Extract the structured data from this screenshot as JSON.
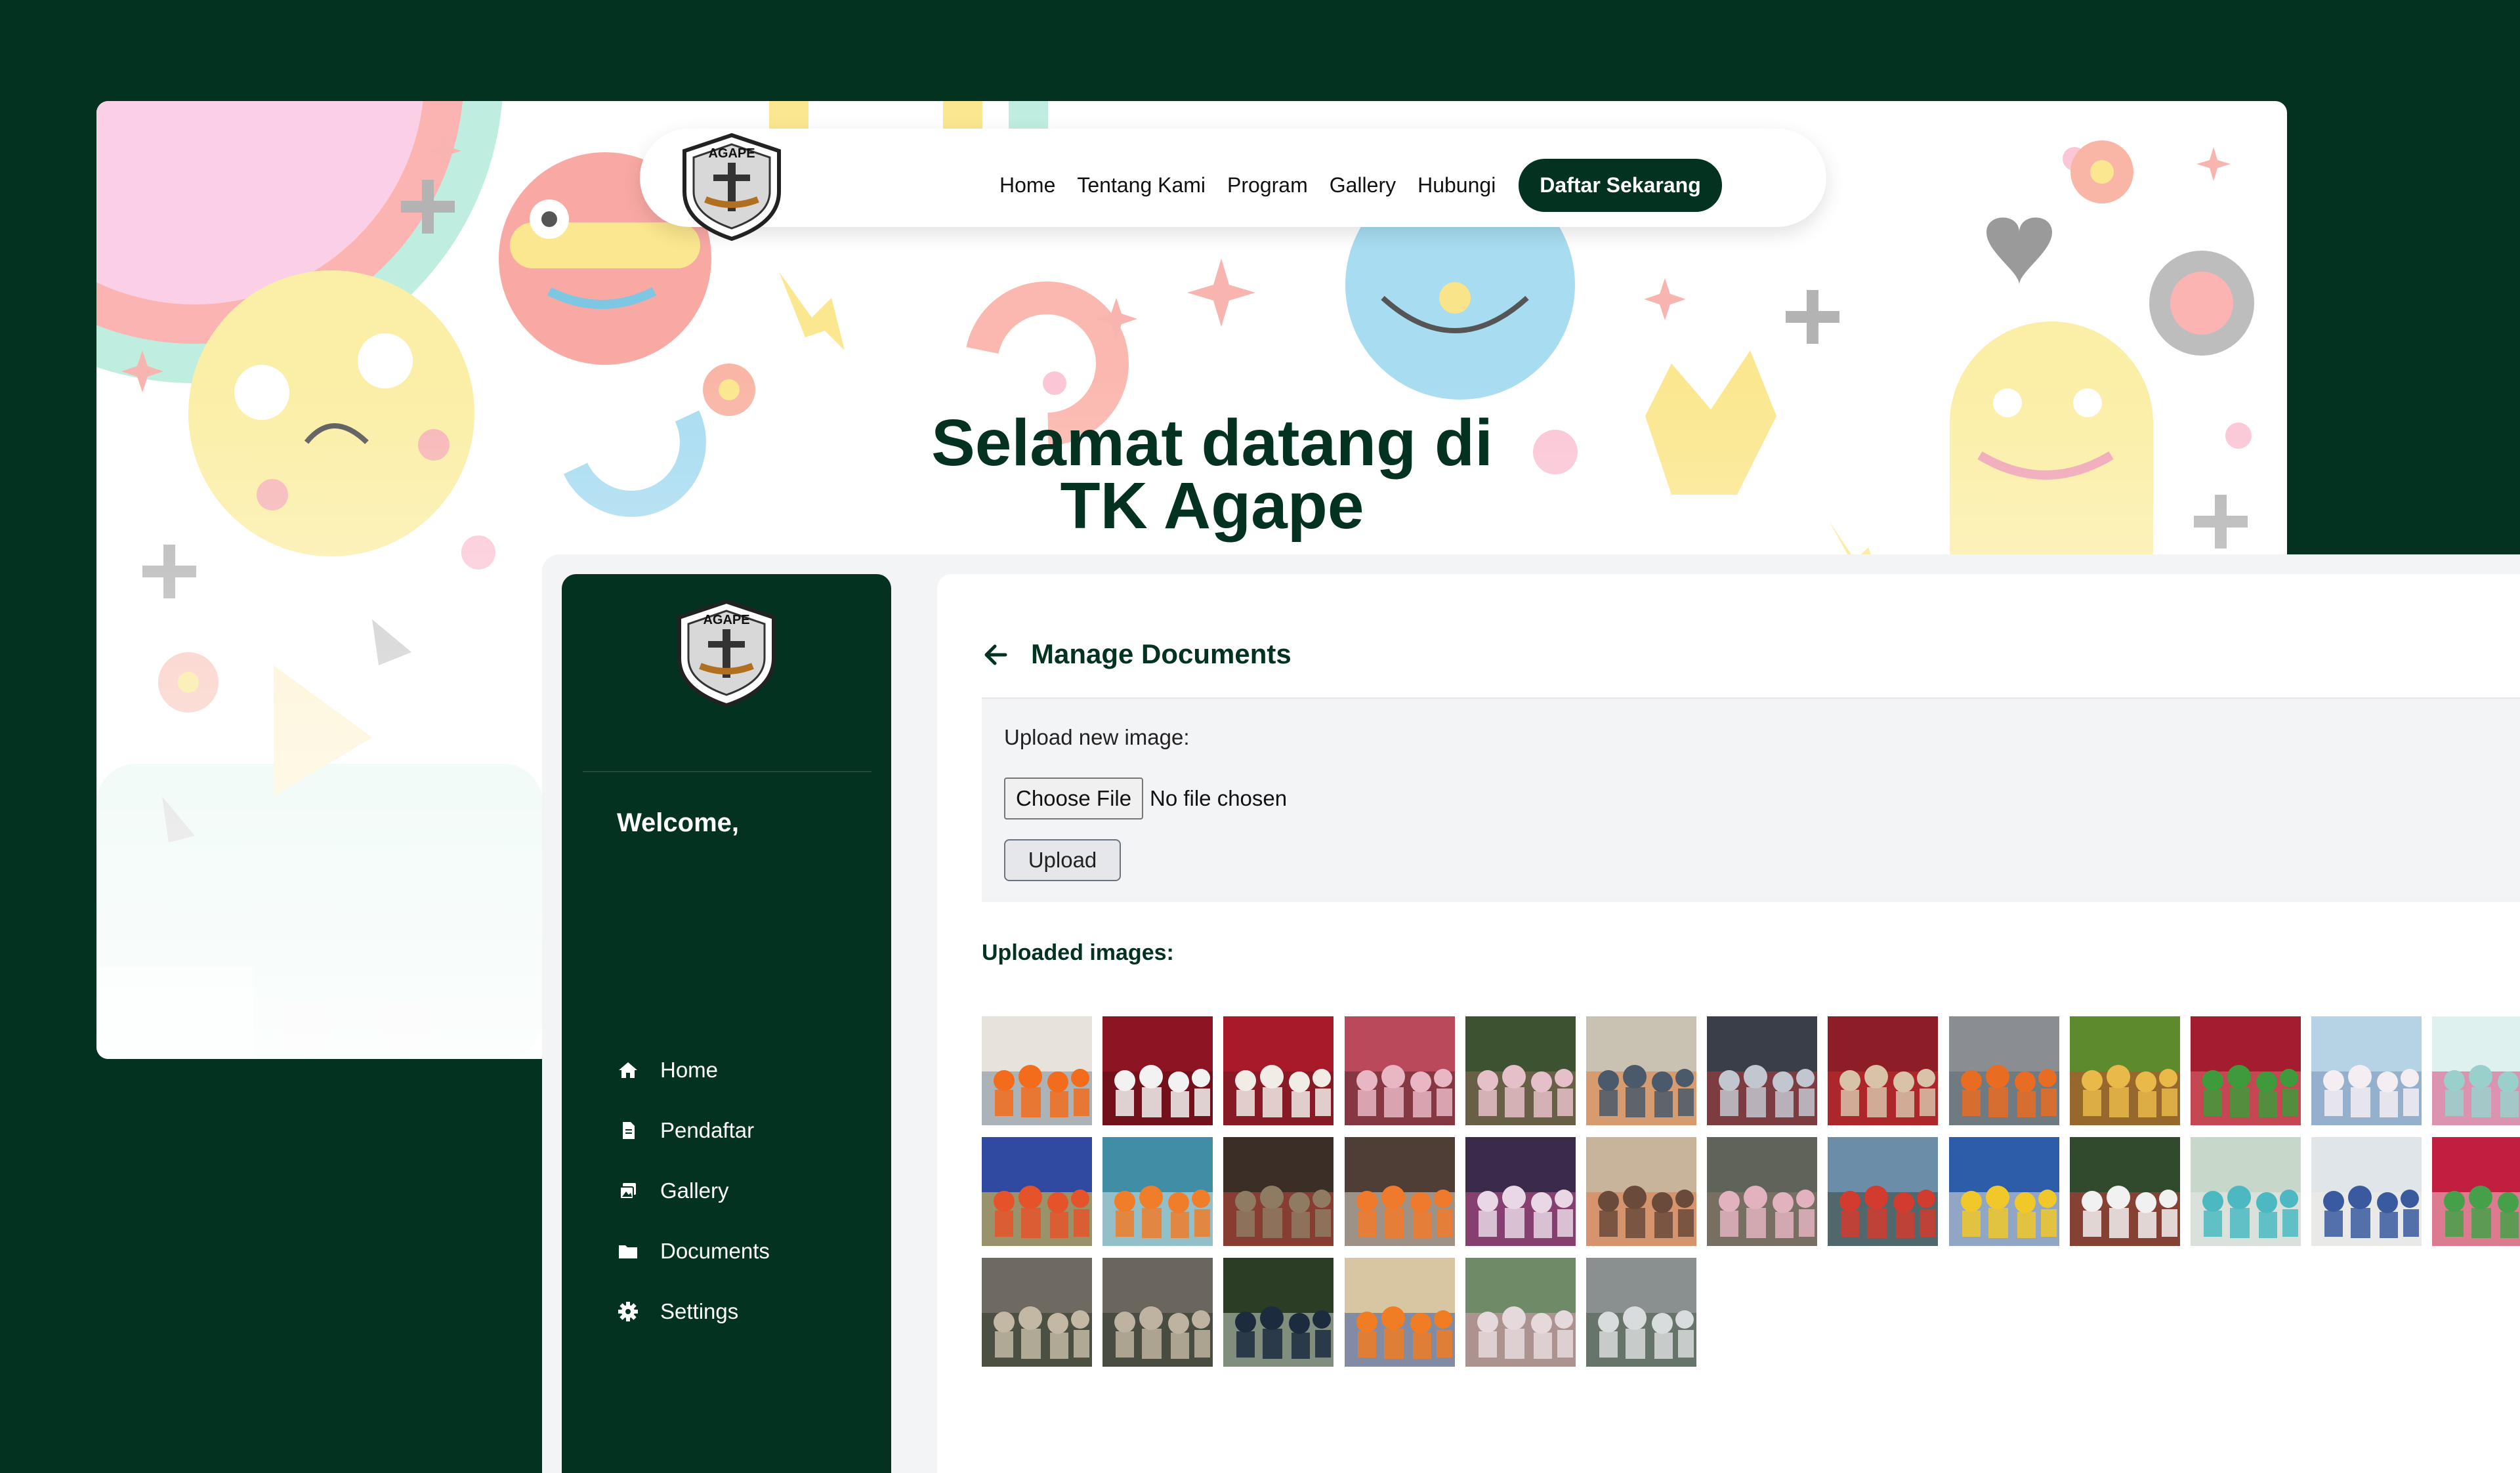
{
  "site": {
    "logo_text": "AGAPE",
    "nav_links": [
      "Home",
      "Tentang Kami",
      "Program",
      "Gallery",
      "Hubungi"
    ],
    "nav_cta": "Daftar Sekarang",
    "hero_title_line1": "Selamat datang di",
    "hero_title_line2": "TK Agape"
  },
  "admin": {
    "logo_text": "AGAPE",
    "welcome": "Welcome,",
    "menu": [
      {
        "label": "Home",
        "icon": "home-icon"
      },
      {
        "label": "Pendaftar",
        "icon": "document-icon"
      },
      {
        "label": "Gallery",
        "icon": "images-icon"
      },
      {
        "label": "Documents",
        "icon": "folder-icon"
      },
      {
        "label": "Settings",
        "icon": "gear-icon"
      }
    ],
    "page_title": "Manage Documents",
    "upload_label": "Upload new image:",
    "choose_file_label": "Choose File",
    "file_status": "No file chosen",
    "upload_button": "Upload",
    "uploaded_heading": "Uploaded images:"
  },
  "gallery": {
    "rows": [
      [
        "classroom-orange",
        "red-stage-dance",
        "group-white-stage",
        "pink-performance",
        "outdoor-pink-dresses",
        "classroom-group",
        "costume-parade",
        "red-stage-group",
        "outdoor-orange-play",
        "colorful-classroom",
        "green-costume-dance",
        "white-tutu-dance",
        "banner-event"
      ],
      [
        "blue-play-area",
        "long-table-meal",
        "seated-group-hall",
        "orange-uniform-group",
        "cake-celebration",
        "kids-at-desks",
        "pink-group-outdoor",
        "playground-red",
        "yellow-costume-kids",
        "kids-with-bags",
        "teacher-outdoor",
        "classroom-activity",
        "pink-stage-group"
      ],
      [
        "rock-wall-kid",
        "rock-wall-kid-2",
        "man-in-suit",
        "orange-kids-sitting",
        "outdoor-group-pink",
        "group-photo-building"
      ]
    ],
    "colors": {
      "classroom-orange": [
        "#e7e3dc",
        "#f26c1c",
        "#7a8a9a"
      ],
      "red-stage-dance": [
        "#8d1422",
        "#f2f2f2",
        "#5c0d15"
      ],
      "group-white-stage": [
        "#a8192a",
        "#f1ede6",
        "#6d1c22"
      ],
      "pink-performance": [
        "#b9495b",
        "#e8b7c3",
        "#5b2a2e"
      ],
      "outdoor-pink-dresses": [
        "#3d5230",
        "#e6c0c9",
        "#8a6a5a"
      ],
      "classroom-group": [
        "#c9c2b2",
        "#4a5a6a",
        "#e07b39"
      ],
      "costume-parade": [
        "#3a3e48",
        "#c2c6cf",
        "#b43a3a"
      ],
      "red-stage-group": [
        "#8d1d26",
        "#d8c3a9",
        "#c82e2e"
      ],
      "outdoor-orange-play": [
        "#8a8e92",
        "#e86c22",
        "#5a6a72"
      ],
      "colorful-classroom": [
        "#5e8a2e",
        "#e9b94a",
        "#c44d2d"
      ],
      "green-costume-dance": [
        "#a41d2e",
        "#3e9a3a",
        "#e06a72"
      ],
      "white-tutu-dance": [
        "#b6d3e6",
        "#f4eef2",
        "#7a93b6"
      ],
      "banner-event": [
        "#dff1ee",
        "#9ad0cc",
        "#d8467d"
      ],
      "blue-play-area": [
        "#2f4aa0",
        "#e5532a",
        "#f0d040"
      ],
      "long-table-meal": [
        "#3f8ea6",
        "#ef7d2a",
        "#d9e7e3"
      ],
      "seated-group-hall": [
        "#3b2e26",
        "#8f7a62",
        "#c74b3a"
      ],
      "orange-uniform-group": [
        "#4e3e36",
        "#f07a2b",
        "#e0d6c8"
      ],
      "cake-celebration": [
        "#3b2a4a",
        "#e9d7e5",
        "#c2528e"
      ],
      "kids-at-desks": [
        "#c8b49a",
        "#6a4a3a",
        "#e07a4a"
      ],
      "pink-group-outdoor": [
        "#5f635a",
        "#e2b3be",
        "#8c7a6b"
      ],
      "playground-red": [
        "#6b8da8",
        "#d13c2e",
        "#3a4a3a"
      ],
      "yellow-costume-kids": [
        "#2d5ca8",
        "#f0c829",
        "#e4e2dd"
      ],
      "kids-with-bags": [
        "#314a2e",
        "#f1f1f1",
        "#c83a3a"
      ],
      "teacher-outdoor": [
        "#c7d7c9",
        "#4bb8c2",
        "#e9e9e9"
      ],
      "classroom-activity": [
        "#dfe5e8",
        "#3a5aa0",
        "#f0eee8"
      ],
      "pink-stage-group": [
        "#c21e3f",
        "#46a04a",
        "#f2c9d4"
      ],
      "rock-wall-kid": [
        "#6e6a62",
        "#c2b8a4",
        "#2f3a2a"
      ],
      "rock-wall-kid-2": [
        "#6a665e",
        "#bdb3a0",
        "#2d3628"
      ],
      "man-in-suit": [
        "#2b3d24",
        "#1c2c3e",
        "#c9d0c6"
      ],
      "orange-kids-sitting": [
        "#d8c6a2",
        "#f07d24",
        "#3b5ca6"
      ],
      "outdoor-group-pink": [
        "#6f8a66",
        "#e6d9dc",
        "#df9bb2"
      ],
      "group-photo-building": [
        "#8a9090",
        "#d8dcdc",
        "#4a5c4a"
      ]
    }
  },
  "colors": {
    "brand_dark_green": "#033221",
    "content_bg": "#ffffff",
    "panel_bg": "#f3f4f6"
  }
}
